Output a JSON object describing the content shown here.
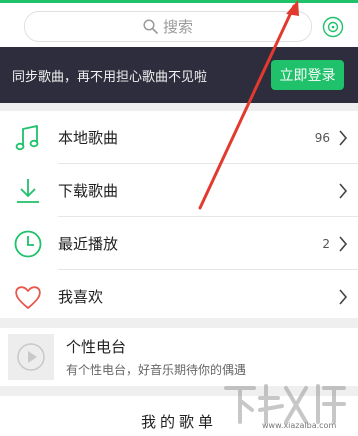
{
  "header": {
    "search_placeholder": "搜索",
    "icons": {
      "search": "search-icon",
      "recognize": "music-recognize-icon"
    }
  },
  "banner": {
    "text": "同步歌曲，再不用担心歌曲不见啦",
    "login_label": "立即登录"
  },
  "menu": {
    "items": [
      {
        "label": "本地歌曲",
        "count": "96",
        "icon": "music-note-icon"
      },
      {
        "label": "下载歌曲",
        "count": "",
        "icon": "download-icon"
      },
      {
        "label": "最近播放",
        "count": "2",
        "icon": "clock-icon"
      },
      {
        "label": "我喜欢",
        "count": "",
        "icon": "heart-icon"
      }
    ]
  },
  "radio": {
    "title": "个性电台",
    "subtitle": "有个性电台，好音乐期待你的偶遇",
    "icon": "play-icon"
  },
  "playlist": {
    "title": "我的歌单"
  },
  "watermark": {
    "logo_text": "下载吧",
    "url": "www.xiazaiba.com"
  },
  "colors": {
    "accent": "#1fc16a",
    "banner_bg": "#2d2d3d",
    "heart": "#e8584d",
    "annotation_arrow": "#e23a2e"
  }
}
